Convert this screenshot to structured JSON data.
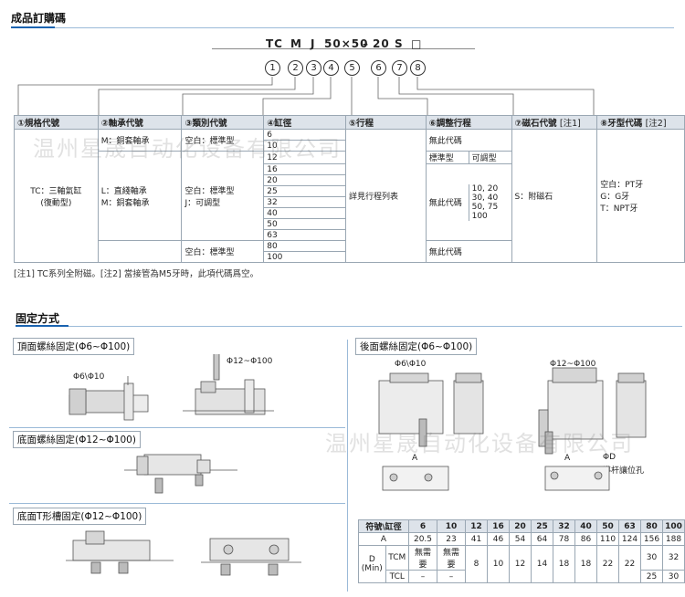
{
  "section1": {
    "title": "成品訂購碼"
  },
  "order_code": {
    "parts": [
      "TC",
      "M",
      "J",
      "50×50",
      "–",
      "20",
      "S",
      "□"
    ],
    "circles": [
      "1",
      "2",
      "3",
      "4",
      "5",
      "6",
      "7",
      "8"
    ]
  },
  "spec_table": {
    "headers": [
      "①規格代號",
      "②軸承代號",
      "③類別代號",
      "④缸徑",
      "⑤行程",
      "⑥調整行程",
      "⑦磁石代號",
      "[注1]",
      "⑧牙型代碼",
      "[注2]"
    ],
    "spec_code": "TC：三軸氣缸\n(復動型)",
    "bearing": [
      "L：直綫軸承",
      "M：銅套軸承"
    ],
    "bearing_top": "M：銅套軸承",
    "type_rows": [
      "空白：標準型",
      "空白：標準型\nJ：可調型",
      "空白：標準型"
    ],
    "bores": [
      "6",
      "10",
      "12",
      "16",
      "20",
      "25",
      "32",
      "40",
      "50",
      "63",
      "80",
      "100"
    ],
    "stroke": "詳見行程列表",
    "adjust_none": "無此代碼",
    "adjust_standard": "標準型",
    "adjust_adjustable": "可調型",
    "adjust_values": "10, 20\n30, 40\n50, 75\n100",
    "adjust_none2": "無此代碼",
    "adjust_none3": "無此代碼",
    "magnet": "S：附磁石",
    "thread": "空白：PT牙\nG：G牙\nT：NPT牙"
  },
  "note": "[注1] TC系列全附磁。[注2] 當接管為M5牙時，此項代碼爲空。",
  "watermark": "温州星晟自动化设备有限公司",
  "section2": {
    "title": "固定方式"
  },
  "panels": {
    "top_screw": "頂面螺絲固定(Φ6~Φ100)",
    "top_small": "Φ6\\Φ10",
    "top_large": "Φ12~Φ100",
    "bottom_screw": "底面螺絲固定(Φ12~Φ100)",
    "t_slot": "底面T形槽固定(Φ12~Φ100)",
    "rear_screw": "後面螺絲固定(Φ6~Φ100)",
    "rear_small": "Φ6\\Φ10",
    "rear_large": "Φ12~Φ100",
    "dim_A": "A",
    "dim_D": "ΦD",
    "guide_hole": "導杆讓位孔"
  },
  "dims_table": {
    "header_label": "符號\\缸徑",
    "bores": [
      "6",
      "10",
      "12",
      "16",
      "20",
      "25",
      "32",
      "40",
      "50",
      "63",
      "80",
      "100"
    ],
    "row_A_label": "A",
    "row_A": [
      "20.5",
      "23",
      "41",
      "46",
      "54",
      "64",
      "78",
      "86",
      "110",
      "124",
      "156",
      "188"
    ],
    "row_D_label": "D",
    "row_D_sub": "(Min)",
    "tcm_label": "TCM",
    "tcl_label": "TCL",
    "tcm": [
      "無需要",
      "無需要"
    ],
    "tcl": [
      "–",
      "–"
    ],
    "d_shared": [
      "8",
      "10",
      "12",
      "14",
      "18",
      "18",
      "22",
      "22"
    ],
    "tcm_tail": [
      "30",
      "32"
    ],
    "tcl_tail": [
      "25",
      "30"
    ]
  }
}
